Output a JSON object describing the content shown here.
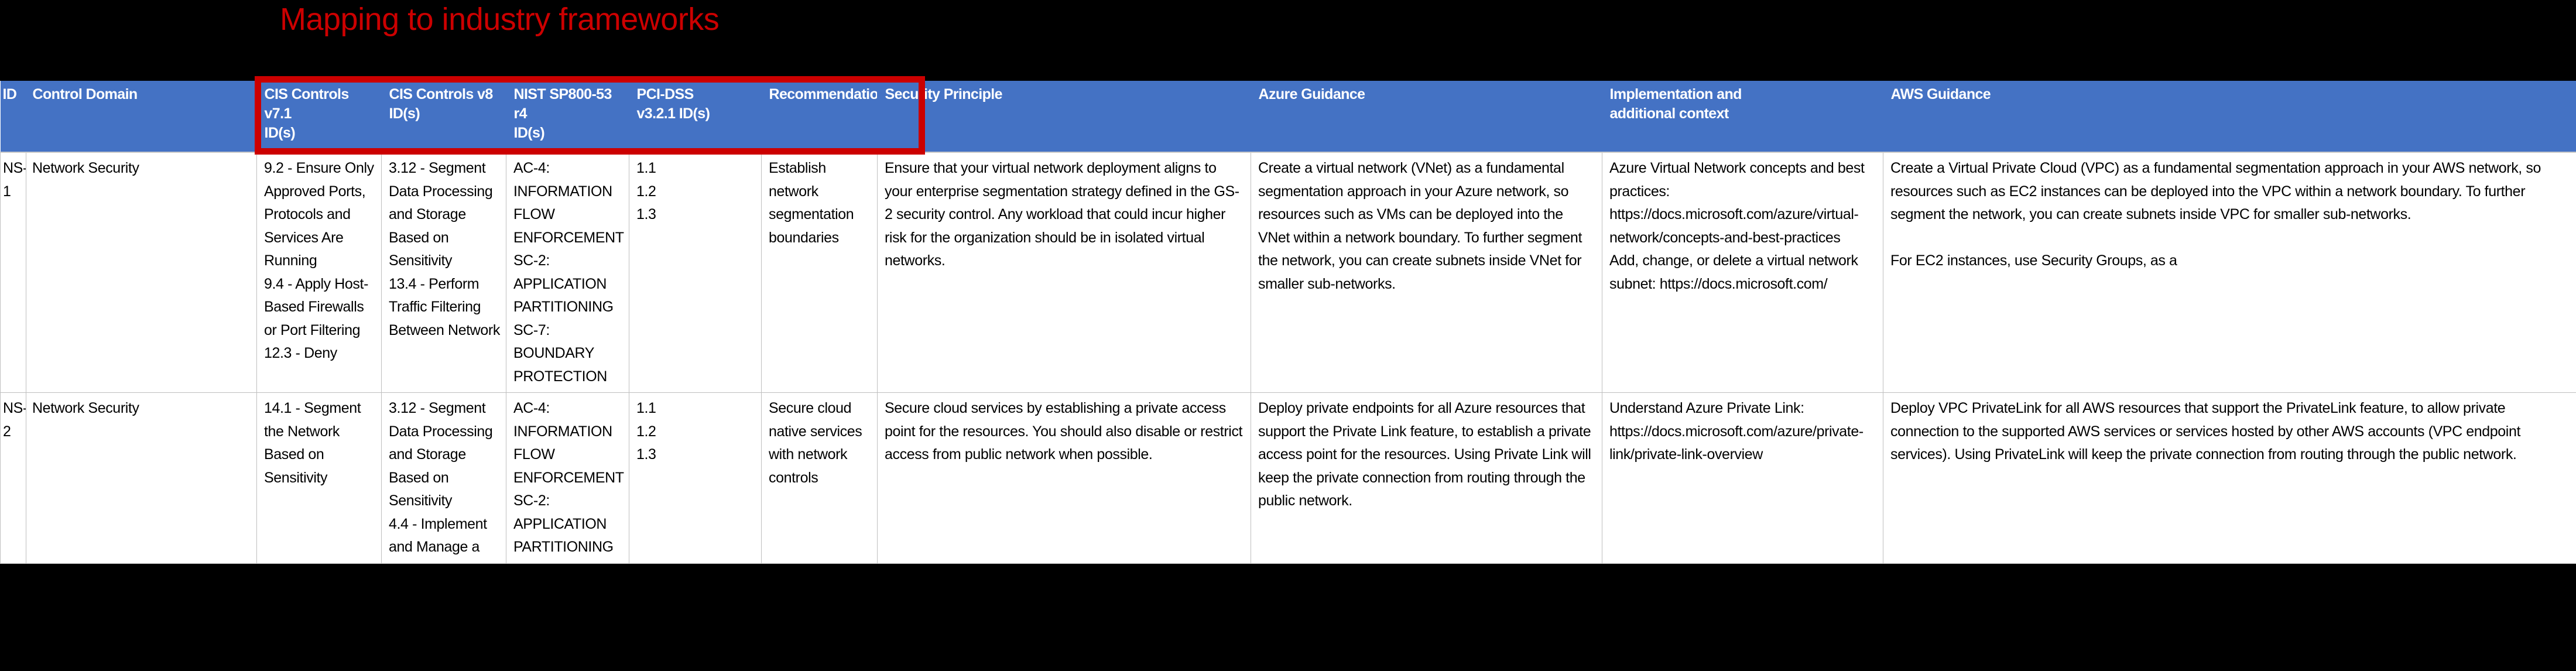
{
  "slide": {
    "title": "Mapping to industry frameworks",
    "title_color": "#CC0000",
    "background_color": "#000000",
    "header_fill": "#4472C4",
    "header_text_color": "#FFFFFF",
    "highlight_color": "#CC0000"
  },
  "table": {
    "columns": [
      {
        "key": "id",
        "label": "ID"
      },
      {
        "key": "domain",
        "label": "Control Domain"
      },
      {
        "key": "cis71",
        "label": "CIS Controls v7.1 ID(s)"
      },
      {
        "key": "cis8",
        "label": "CIS Controls v8 ID(s)"
      },
      {
        "key": "nist",
        "label": "NIST SP800-53 r4 ID(s)"
      },
      {
        "key": "pci",
        "label": "PCI-DSS v3.2.1 ID(s)"
      },
      {
        "key": "rec",
        "label": "Recommendation"
      },
      {
        "key": "princ",
        "label": "Security Principle"
      },
      {
        "key": "azure",
        "label": "Azure Guidance"
      },
      {
        "key": "impl",
        "label": "Implementation and additional context"
      },
      {
        "key": "aws",
        "label": "AWS Guidance"
      }
    ],
    "header_labels": {
      "id": "ID",
      "domain": "Control Domain",
      "cis71_line1": "CIS Controls v7.1",
      "cis71_line2": "ID(s)",
      "cis8_line1": "CIS Controls v8",
      "cis8_line2": "ID(s)",
      "nist_line1": "NIST SP800-53 r4",
      "nist_line2": "ID(s)",
      "pci_line1": "PCI-DSS",
      "pci_line2": "v3.2.1 ID(s)",
      "rec": "Recommendation",
      "princ": "Security Principle",
      "azure": "Azure Guidance",
      "impl_line1": "Implementation and",
      "impl_line2": "additional context",
      "aws": "AWS Guidance"
    },
    "rows": [
      {
        "id": "NS-1",
        "domain": "Network Security",
        "cis71": "9.2 - Ensure Only Approved Ports, Protocols and Services Are Running\n9.4 - Apply Host-Based Firewalls or Port Filtering\n12.3 - Deny",
        "cis8": "3.12 - Segment Data Processing and Storage Based on Sensitivity\n13.4 - Perform Traffic Filtering Between Network",
        "nist": "AC-4: INFORMATION FLOW ENFORCEMENT\nSC-2: APPLICATION PARTITIONING\nSC-7: BOUNDARY PROTECTION",
        "pci": "1.1\n1.2\n1.3",
        "rec": "Establish network segmentation boundaries",
        "princ": "Ensure that your virtual network deployment aligns to your enterprise segmentation strategy defined in the GS-2 security control. Any workload that could incur higher risk for the organization should be in isolated virtual networks.",
        "azure": "Create a virtual network (VNet) as a fundamental segmentation approach in your Azure network, so resources such as VMs can be deployed into the VNet within a network boundary. To further segment the network, you can create subnets inside VNet for smaller sub-networks.",
        "impl": "Azure Virtual Network concepts and best practices: https://docs.microsoft.com/azure/virtual-network/concepts-and-best-practices\nAdd, change, or delete a virtual network subnet: https://docs.microsoft.com/",
        "aws": "Create a Virtual Private Cloud (VPC) as a fundamental segmentation approach in your AWS network, so resources such as EC2 instances can be deployed into the VPC within a network boundary. To further segment the network, you can create subnets inside VPC for smaller sub-networks.\n\nFor EC2 instances, use Security Groups, as a"
      },
      {
        "id": "NS-2",
        "domain": "Network Security",
        "cis71": "14.1 - Segment the Network Based on Sensitivity",
        "cis8": "3.12 - Segment Data Processing and Storage Based on Sensitivity\n4.4 - Implement and Manage a",
        "nist": "AC-4: INFORMATION FLOW ENFORCEMENT\nSC-2: APPLICATION PARTITIONING",
        "pci": "1.1\n1.2\n1.3",
        "rec": "Secure cloud native services with network controls",
        "princ": "Secure cloud services by establishing a private access point for the resources. You should also disable or restrict access from public network when possible.",
        "azure": "Deploy private endpoints for all Azure resources that support the Private Link feature, to establish a private access point for the resources. Using Private Link will keep the private connection from routing through the public network.",
        "impl": "Understand Azure Private Link: https://docs.microsoft.com/azure/private-link/private-link-overview",
        "aws": "Deploy VPC PrivateLink for all AWS resources that support the PrivateLink feature, to allow private connection to the supported AWS services or services hosted by other AWS accounts (VPC endpoint services). Using PrivateLink will keep the private connection from routing through the public network."
      }
    ]
  }
}
